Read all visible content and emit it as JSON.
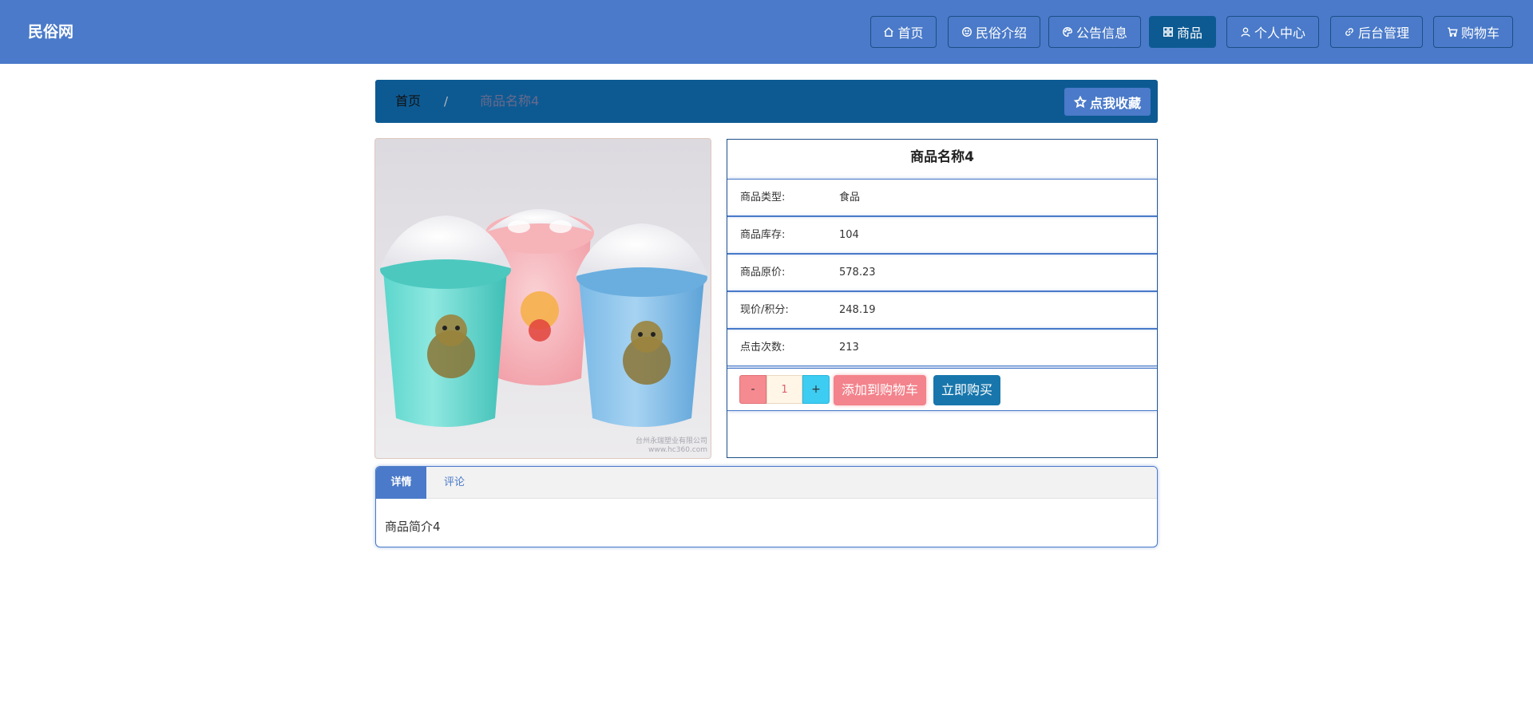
{
  "header": {
    "brand": "民俗网",
    "nav": [
      {
        "label": "首页",
        "icon": "home-icon"
      },
      {
        "label": "民俗介绍",
        "icon": "smile-icon"
      },
      {
        "label": "公告信息",
        "icon": "palette-icon"
      },
      {
        "label": "商品",
        "icon": "grid-icon",
        "active": true
      },
      {
        "label": "个人中心",
        "icon": "user-icon"
      },
      {
        "label": "后台管理",
        "icon": "link-icon"
      },
      {
        "label": "购物车",
        "icon": "cart-icon"
      }
    ]
  },
  "breadcrumb": {
    "home": "首页",
    "separator": "/",
    "current": "商品名称4",
    "favorite_label": "点我收藏"
  },
  "product": {
    "image_watermark_line1": "台州永瑞塑业有限公司",
    "image_watermark_line2": "www.hc360.com",
    "title": "商品名称4",
    "rows": [
      {
        "label": "商品类型:",
        "value": "食品"
      },
      {
        "label": "商品库存:",
        "value": "104"
      },
      {
        "label": "商品原价:",
        "value": "578.23"
      },
      {
        "label": "现价/积分:",
        "value": "248.19"
      },
      {
        "label": "点击次数:",
        "value": "213"
      }
    ],
    "quantity": "1",
    "minus_label": "-",
    "plus_label": "+",
    "add_to_cart_label": "添加到购物车",
    "buy_now_label": "立即购买"
  },
  "tabs": {
    "items": [
      {
        "label": "详情",
        "active": true
      },
      {
        "label": "评论",
        "active": false
      }
    ],
    "content": "商品简介4"
  },
  "colors": {
    "primary": "#4a7ac9",
    "dark": "#0d5a93",
    "pink": "#f3838c",
    "cyan": "#3dccf2",
    "buy": "#1876ac"
  }
}
